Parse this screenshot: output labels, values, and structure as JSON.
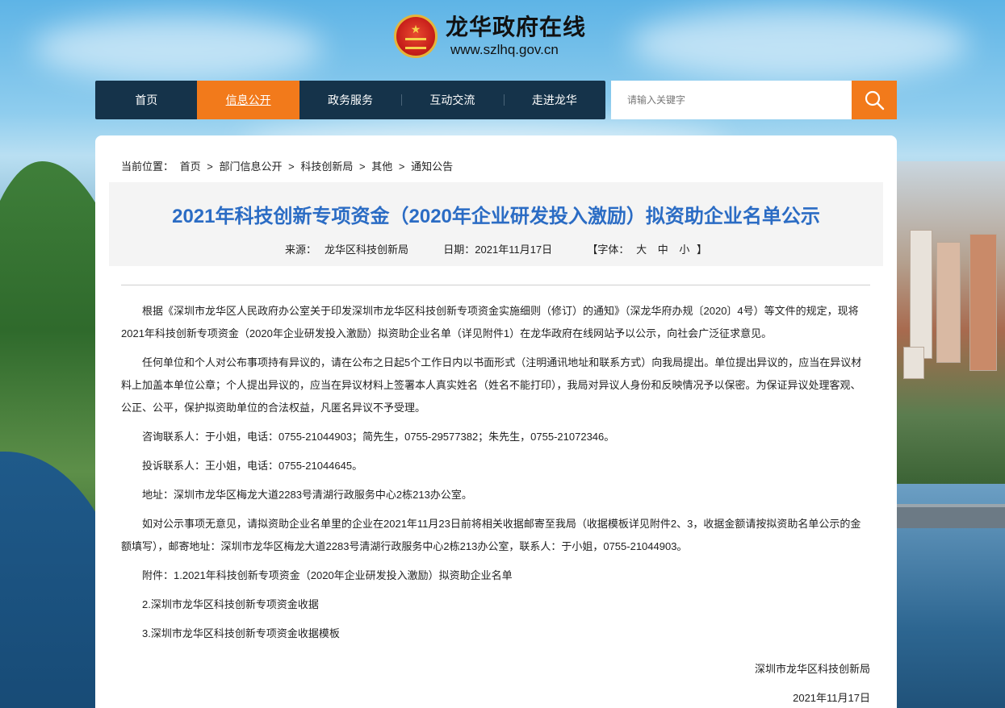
{
  "site": {
    "title": "龙华政府在线",
    "url": "www.szlhq.gov.cn"
  },
  "nav": {
    "items": [
      {
        "label": "首页"
      },
      {
        "label": "信息公开"
      },
      {
        "label": "政务服务"
      },
      {
        "label": "互动交流"
      },
      {
        "label": "走进龙华"
      }
    ],
    "active_index": 1
  },
  "search": {
    "placeholder": "请输入关键字"
  },
  "breadcrumb": {
    "label": "当前位置：",
    "items": [
      "首页",
      "部门信息公开",
      "科技创新局",
      "其他",
      "通知公告"
    ],
    "separator": ">"
  },
  "article": {
    "title": "2021年科技创新专项资金（2020年企业研发投入激励）拟资助企业名单公示",
    "source_label": "来源：",
    "source": "龙华区科技创新局",
    "date_label": "日期：",
    "date": "2021年11月17日",
    "font_label": "【字体：",
    "font_large": "大",
    "font_medium": "中",
    "font_small": "小",
    "font_close": "】",
    "paragraphs": [
      "根据《深圳市龙华区人民政府办公室关于印发深圳市龙华区科技创新专项资金实施细则（修订）的通知》（深龙华府办规〔2020〕4号）等文件的规定，现将2021年科技创新专项资金（2020年企业研发投入激励）拟资助企业名单（详见附件1）在龙华政府在线网站予以公示，向社会广泛征求意见。",
      "任何单位和个人对公布事项持有异议的，请在公布之日起5个工作日内以书面形式（注明通讯地址和联系方式）向我局提出。单位提出异议的，应当在异议材料上加盖本单位公章；个人提出异议的，应当在异议材料上签署本人真实姓名（姓名不能打印），我局对异议人身份和反映情况予以保密。为保证异议处理客观、公正、公平，保护拟资助单位的合法权益，凡匿名异议不予受理。",
      "咨询联系人：于小姐，电话：0755-21044903；简先生，0755-29577382；朱先生，0755-21072346。",
      "投诉联系人：王小姐，电话：0755-21044645。",
      "地址：深圳市龙华区梅龙大道2283号清湖行政服务中心2栋213办公室。",
      "如对公示事项无意见，请拟资助企业名单里的企业在2021年11月23日前将相关收据邮寄至我局（收据模板详见附件2、3，收据金额请按拟资助名单公示的金额填写），邮寄地址：深圳市龙华区梅龙大道2283号清湖行政服务中心2栋213办公室，联系人：于小姐，0755-21044903。"
    ],
    "attachments": [
      "附件：1.2021年科技创新专项资金（2020年企业研发投入激励）拟资助企业名单",
      "2.深圳市龙华区科技创新专项资金收据",
      "3.深圳市龙华区科技创新专项资金收据模板"
    ],
    "signature": "深圳市龙华区科技创新局",
    "sign_date": "2021年11月17日"
  },
  "colors": {
    "nav_bg": "#15334a",
    "accent": "#f27a1b",
    "title_blue": "#2b6cc4"
  }
}
